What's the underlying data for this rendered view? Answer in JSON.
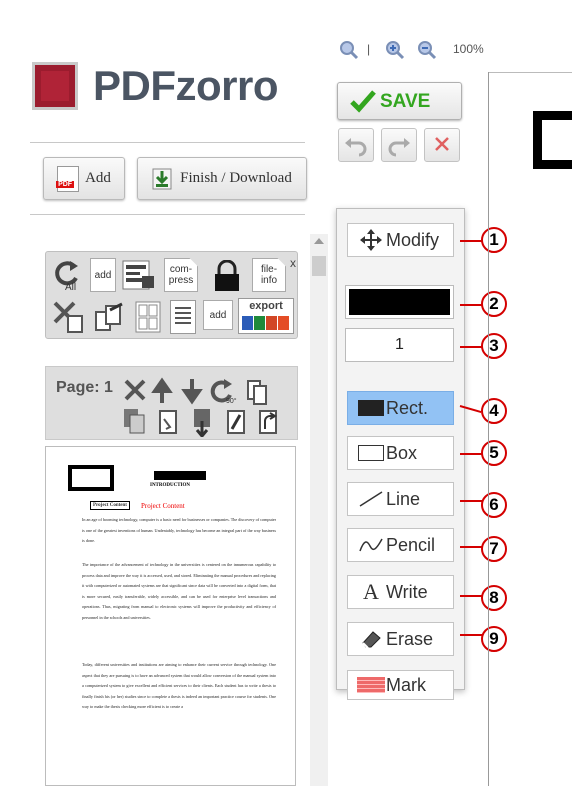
{
  "app": {
    "logo_text": "PDFzorro",
    "zoom_level": "100%"
  },
  "toolbar": {
    "add_label": "Add",
    "finish_label": "Finish / Download",
    "save_label": "SAVE"
  },
  "page_tools": {
    "items": [
      {
        "label": "All",
        "icon": "rotate-all-icon"
      },
      {
        "label": "add",
        "icon": "add-page-icon"
      },
      {
        "label": "",
        "icon": "form-icon"
      },
      {
        "label": "com-\npress",
        "icon": "compress-icon"
      },
      {
        "label": "",
        "icon": "lock-icon"
      },
      {
        "label": "file-\ninfo",
        "icon": "file-info-icon"
      },
      {
        "label": "",
        "icon": "delete-pages-icon"
      },
      {
        "label": "",
        "icon": "extract-icon"
      },
      {
        "label": "",
        "icon": "grid-icon"
      },
      {
        "label": "add",
        "icon": "add-text-page-icon"
      },
      {
        "label": "export",
        "icon": "export-icon"
      }
    ],
    "close_label": "x"
  },
  "page_bar": {
    "label": "Page: 1"
  },
  "thumbnail": {
    "heading": "INTRODUCTION",
    "box_label": "Project Content",
    "red_label": "Project Content",
    "paragraphs": [
      "In an age of booming technology, computer is a basic need for businesses or companies. The discovery of computer is one of the greatest inventions of human. Undeniably, technology has become an integral part of the way business is done.",
      "The importance of the advancement of technology in the universities is centered on the innumerous capability to process data and improve the way it is accessed, used, and stored. Eliminating the manual procedures and replacing it with computerized or automated systems are that significant since data will be converted into a digital form, that is more secured, easily transferable, widely accessible, and can be used for enterprise level transactions and operations. Thus, migrating from manual to electronic systems will improve the productivity and efficiency of personnel in the schools and universities.",
      "Today, different universities and institutions are aiming to enhance their current service through technology. One aspect that they are pursuing is to have an advanced system that would allow conversion of the manual system into a computerized system to give excellent and efficient services to their clients. Each student has to write a thesis to finally finish his (or her) studies since to complete a thesis is indeed an important practice course for students. One way to make the thesis checking more efficient is to create a"
    ]
  },
  "draw_panel": {
    "tools": [
      {
        "label": "Modify",
        "icon": "move-arrows-icon",
        "callout": "1"
      },
      {
        "label": "",
        "icon": "color-swatch",
        "callout": "2",
        "color": "#000000"
      },
      {
        "label": "1",
        "icon": "stroke-width",
        "callout": "3"
      },
      {
        "label": "Rect.",
        "icon": "filled-rect-icon",
        "callout": "4",
        "active": true
      },
      {
        "label": "Box",
        "icon": "box-outline-icon",
        "callout": "5"
      },
      {
        "label": "Line",
        "icon": "line-icon",
        "callout": "6"
      },
      {
        "label": "Pencil",
        "icon": "pencil-curve-icon",
        "callout": "7"
      },
      {
        "label": "Write",
        "icon": "text-a-icon",
        "callout": "8"
      },
      {
        "label": "Erase",
        "icon": "eraser-icon",
        "callout": "9"
      },
      {
        "label": "Mark",
        "icon": "highlight-mark-icon",
        "callout": ""
      }
    ]
  },
  "colors": {
    "accent_red": "#d40000",
    "save_green": "#33a61f",
    "active_tool": "#92c2f4",
    "logo": "#9b1c2e"
  }
}
